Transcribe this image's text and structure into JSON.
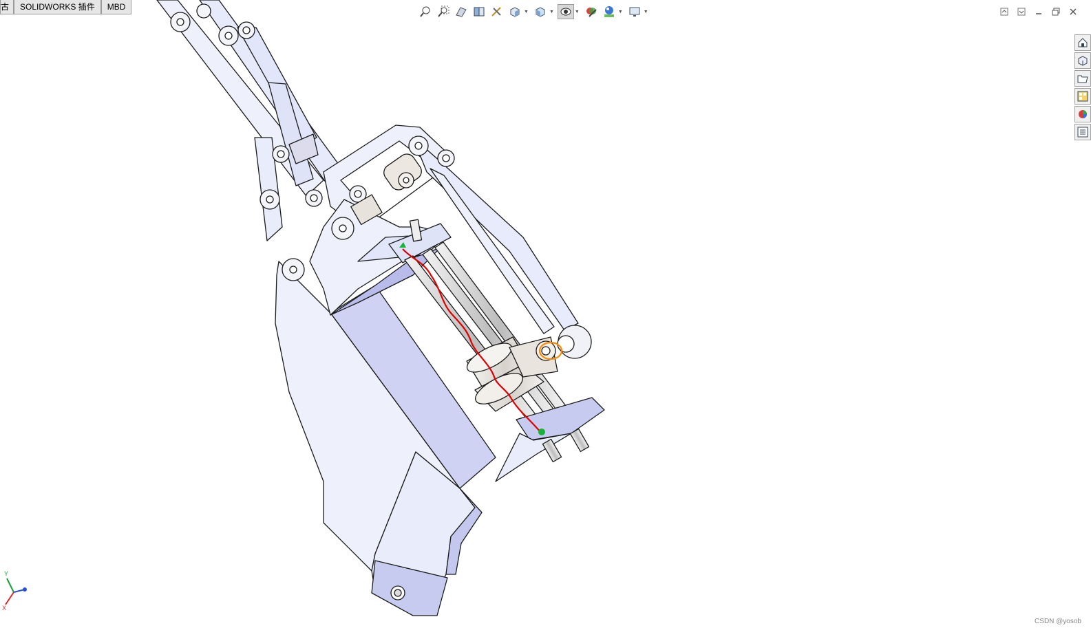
{
  "tabs": [
    "古",
    "SOLIDWORKS 插件",
    "MBD"
  ],
  "heads_up_toolbar": {
    "icons": [
      "zoom-to-fit-icon",
      "zoom-to-area-icon",
      "previous-view-icon",
      "section-view-icon",
      "dynamic-annotation-icon",
      "view-orientation-icon",
      "display-style-icon",
      "hide-show-items-icon",
      "edit-appearance-icon",
      "apply-scene-icon",
      "view-settings-icon"
    ]
  },
  "window_controls": [
    "restore-up-icon",
    "restore-down-icon",
    "minimize-icon",
    "maximize-icon",
    "close-icon"
  ],
  "task_pane": [
    "solidworks-resources-icon",
    "design-library-icon",
    "file-explorer-icon",
    "view-palette-icon",
    "appearances-icon",
    "custom-properties-icon"
  ],
  "triad": {
    "x": "X",
    "y": "Y"
  },
  "watermark": "CSDN @yosob",
  "colors": {
    "part_face": "#e9edfb",
    "part_shade": "#c8cbf0",
    "outline": "#1a1a1a",
    "path_red": "#e00000",
    "point_green": "#15b33a",
    "highlight_orange": "#ff8a00"
  }
}
